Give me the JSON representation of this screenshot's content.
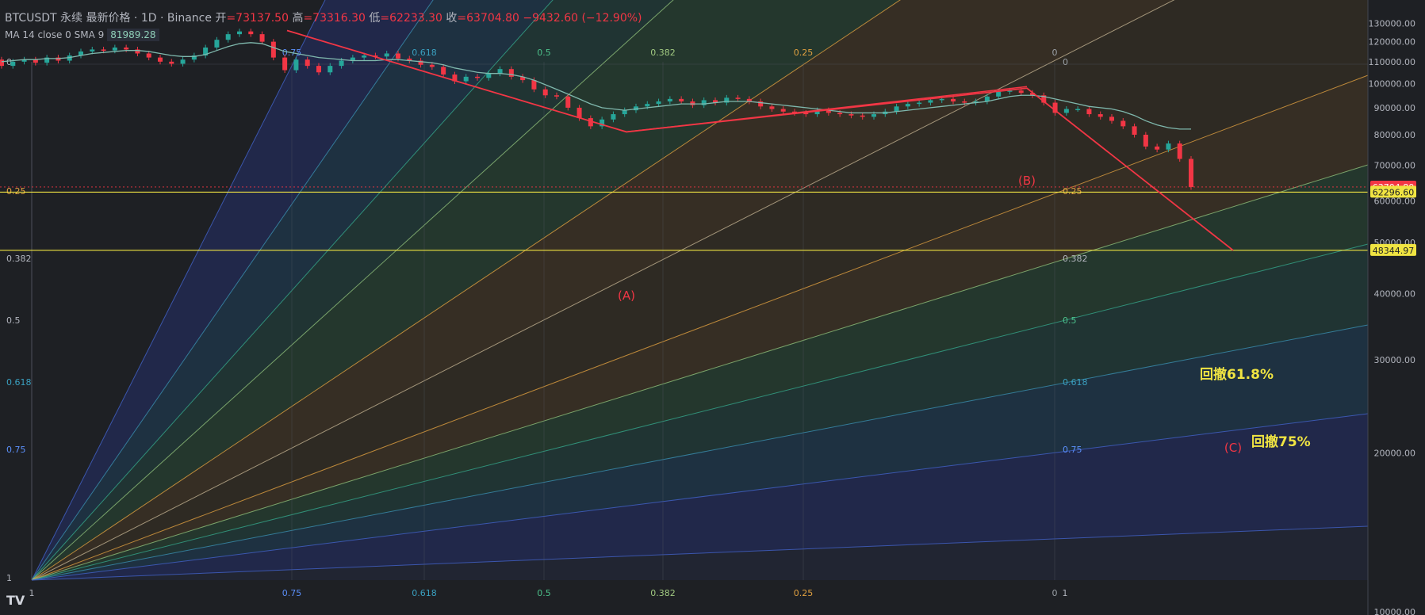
{
  "header": {
    "symbol": "BTCUSDT 永续 最新价格 · 1D · Binance",
    "open_label": "开",
    "open": "=73137.50",
    "high_label": "高",
    "high": "=73316.30",
    "low_label": "低",
    "low": "=62233.30",
    "close_label": "收",
    "close": "=63704.80",
    "change": "−9432.60 (−12.90%)"
  },
  "indicator": {
    "label": "MA 14 close 0 SMA 9",
    "value": "81989.28"
  },
  "colors": {
    "bull": "#26a69a",
    "bear": "#f23645",
    "ma": "#7fb8ad",
    "wave": "#f23645",
    "hline": "#f0e442"
  },
  "chart_data": {
    "type": "candlestick",
    "y_axis": {
      "scale": "log",
      "ylim": [
        10000,
        140000
      ],
      "ticks": [
        10000,
        20000,
        30000,
        40000,
        50000,
        60000,
        70000,
        80000,
        90000,
        100000,
        110000,
        120000,
        130000
      ],
      "tick_labels": [
        "10000.00",
        "20000.00",
        "30000.00",
        "40000.00",
        "50000.00",
        "60000.00",
        "70000.00",
        "80000.00",
        "90000.00",
        "100000.00",
        "110000.00",
        "120000.00",
        "130000.00"
      ]
    },
    "fan_levels": [
      "0.75",
      "0.618",
      "0.5",
      "0.382",
      "0.25",
      "0"
    ],
    "left_levels": [
      "0",
      "0.25",
      "0.382",
      "0.5",
      "0.618",
      "0.75",
      "1"
    ],
    "bottom_labels": [
      "1",
      "0.75",
      "0.618",
      "0.5",
      "0.382",
      "0.25",
      "0",
      "1"
    ],
    "right_levels": [
      "0",
      "0.25",
      "0.382",
      "0.5",
      "0.618",
      "0.75"
    ],
    "price_tags": [
      {
        "label": "63704.80",
        "value": 63704.8,
        "style": "current"
      },
      {
        "label": "62296.60",
        "value": 62296.6,
        "style": "level"
      },
      {
        "label": "48344.97",
        "value": 48344.97,
        "style": "level"
      }
    ],
    "horizontal_lines": [
      62296.6,
      48344.97
    ],
    "waves": [
      {
        "label": "",
        "price": 126000
      },
      {
        "label": "(A)",
        "price": 81000
      },
      {
        "label": "(B)",
        "price": 98000
      },
      {
        "label": "(C)",
        "price": 48344.97
      }
    ],
    "annotations": [
      "回撤61.8%",
      "回撤75%"
    ],
    "closes": [
      108000,
      110000,
      111000,
      109500,
      112000,
      110500,
      113000,
      115000,
      116000,
      115500,
      117000,
      116000,
      114000,
      112000,
      110000,
      109000,
      111000,
      113000,
      117000,
      121000,
      124000,
      125500,
      124000,
      120000,
      112000,
      106000,
      111000,
      108000,
      105000,
      108000,
      110500,
      112000,
      113000,
      112500,
      114000,
      111500,
      110500,
      108500,
      107500,
      104000,
      101000,
      103000,
      102500,
      104500,
      106500,
      103000,
      101500,
      97500,
      95000,
      94500,
      90000,
      86000,
      83000,
      85500,
      87500,
      89000,
      90500,
      91500,
      92500,
      93500,
      92500,
      91000,
      93000,
      92000,
      94000,
      93500,
      92500,
      90500,
      89500,
      88500,
      88000,
      87500,
      89000,
      88000,
      87500,
      87000,
      86500,
      87500,
      88500,
      90500,
      91500,
      92000,
      93000,
      93500,
      92500,
      92000,
      92500,
      94500,
      96500,
      97000,
      96000,
      95000,
      92000,
      88000,
      89500,
      89500,
      87500,
      86500,
      85000,
      83000,
      80000,
      76000,
      75000,
      77000,
      72000,
      63704.8
    ],
    "ma": [
      110000,
      110500,
      111000,
      111000,
      111500,
      111500,
      112000,
      113000,
      114000,
      114500,
      115000,
      115500,
      115500,
      115000,
      114000,
      113000,
      112500,
      112500,
      113500,
      115500,
      117500,
      119000,
      119500,
      119000,
      117000,
      115000,
      114000,
      113000,
      112000,
      111500,
      111000,
      110500,
      110500,
      110500,
      111000,
      111000,
      110500,
      110000,
      109500,
      108500,
      107000,
      106000,
      105000,
      104500,
      104500,
      104000,
      103000,
      101500,
      99500,
      97500,
      95500,
      93500,
      91500,
      90000,
      89500,
      89000,
      89500,
      90000,
      90500,
      91000,
      91500,
      91500,
      91500,
      92000,
      92500,
      92500,
      92500,
      92000,
      91500,
      91000,
      90500,
      90000,
      89500,
      89000,
      88500,
      88000,
      88000,
      88000,
      88000,
      88500,
      89000,
      89500,
      90000,
      90500,
      91000,
      91500,
      92000,
      92500,
      93500,
      94500,
      95000,
      95000,
      94500,
      93500,
      92500,
      91500,
      90500,
      90000,
      89500,
      88500,
      87000,
      85000,
      83500,
      82500,
      82000,
      81989.28
    ]
  }
}
